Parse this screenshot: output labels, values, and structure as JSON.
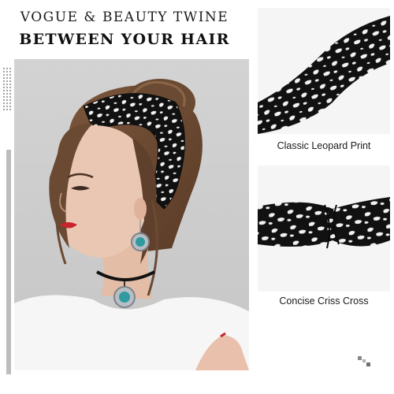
{
  "headline": {
    "line1": "VOGUE & BEAUTY TWINE",
    "line2": "BETWEEN YOUR HAIR"
  },
  "images": {
    "main": {
      "icon": "model-wearing-leopard-headband"
    },
    "thumb_top": {
      "icon": "leopard-headband-closeup"
    },
    "thumb_bottom": {
      "icon": "criss-cross-headband-closeup"
    }
  },
  "captions": {
    "top": "Classic Leopard Print",
    "bottom": "Concise Criss Cross"
  },
  "colors": {
    "pattern_dark": "#111111",
    "pattern_light": "#f2f2f2",
    "accent_bar": "#bdbdbd",
    "hair": "#6b4a33",
    "skin": "#eac7b3",
    "lips": "#c8242c",
    "turquoise": "#2f9aa0"
  }
}
